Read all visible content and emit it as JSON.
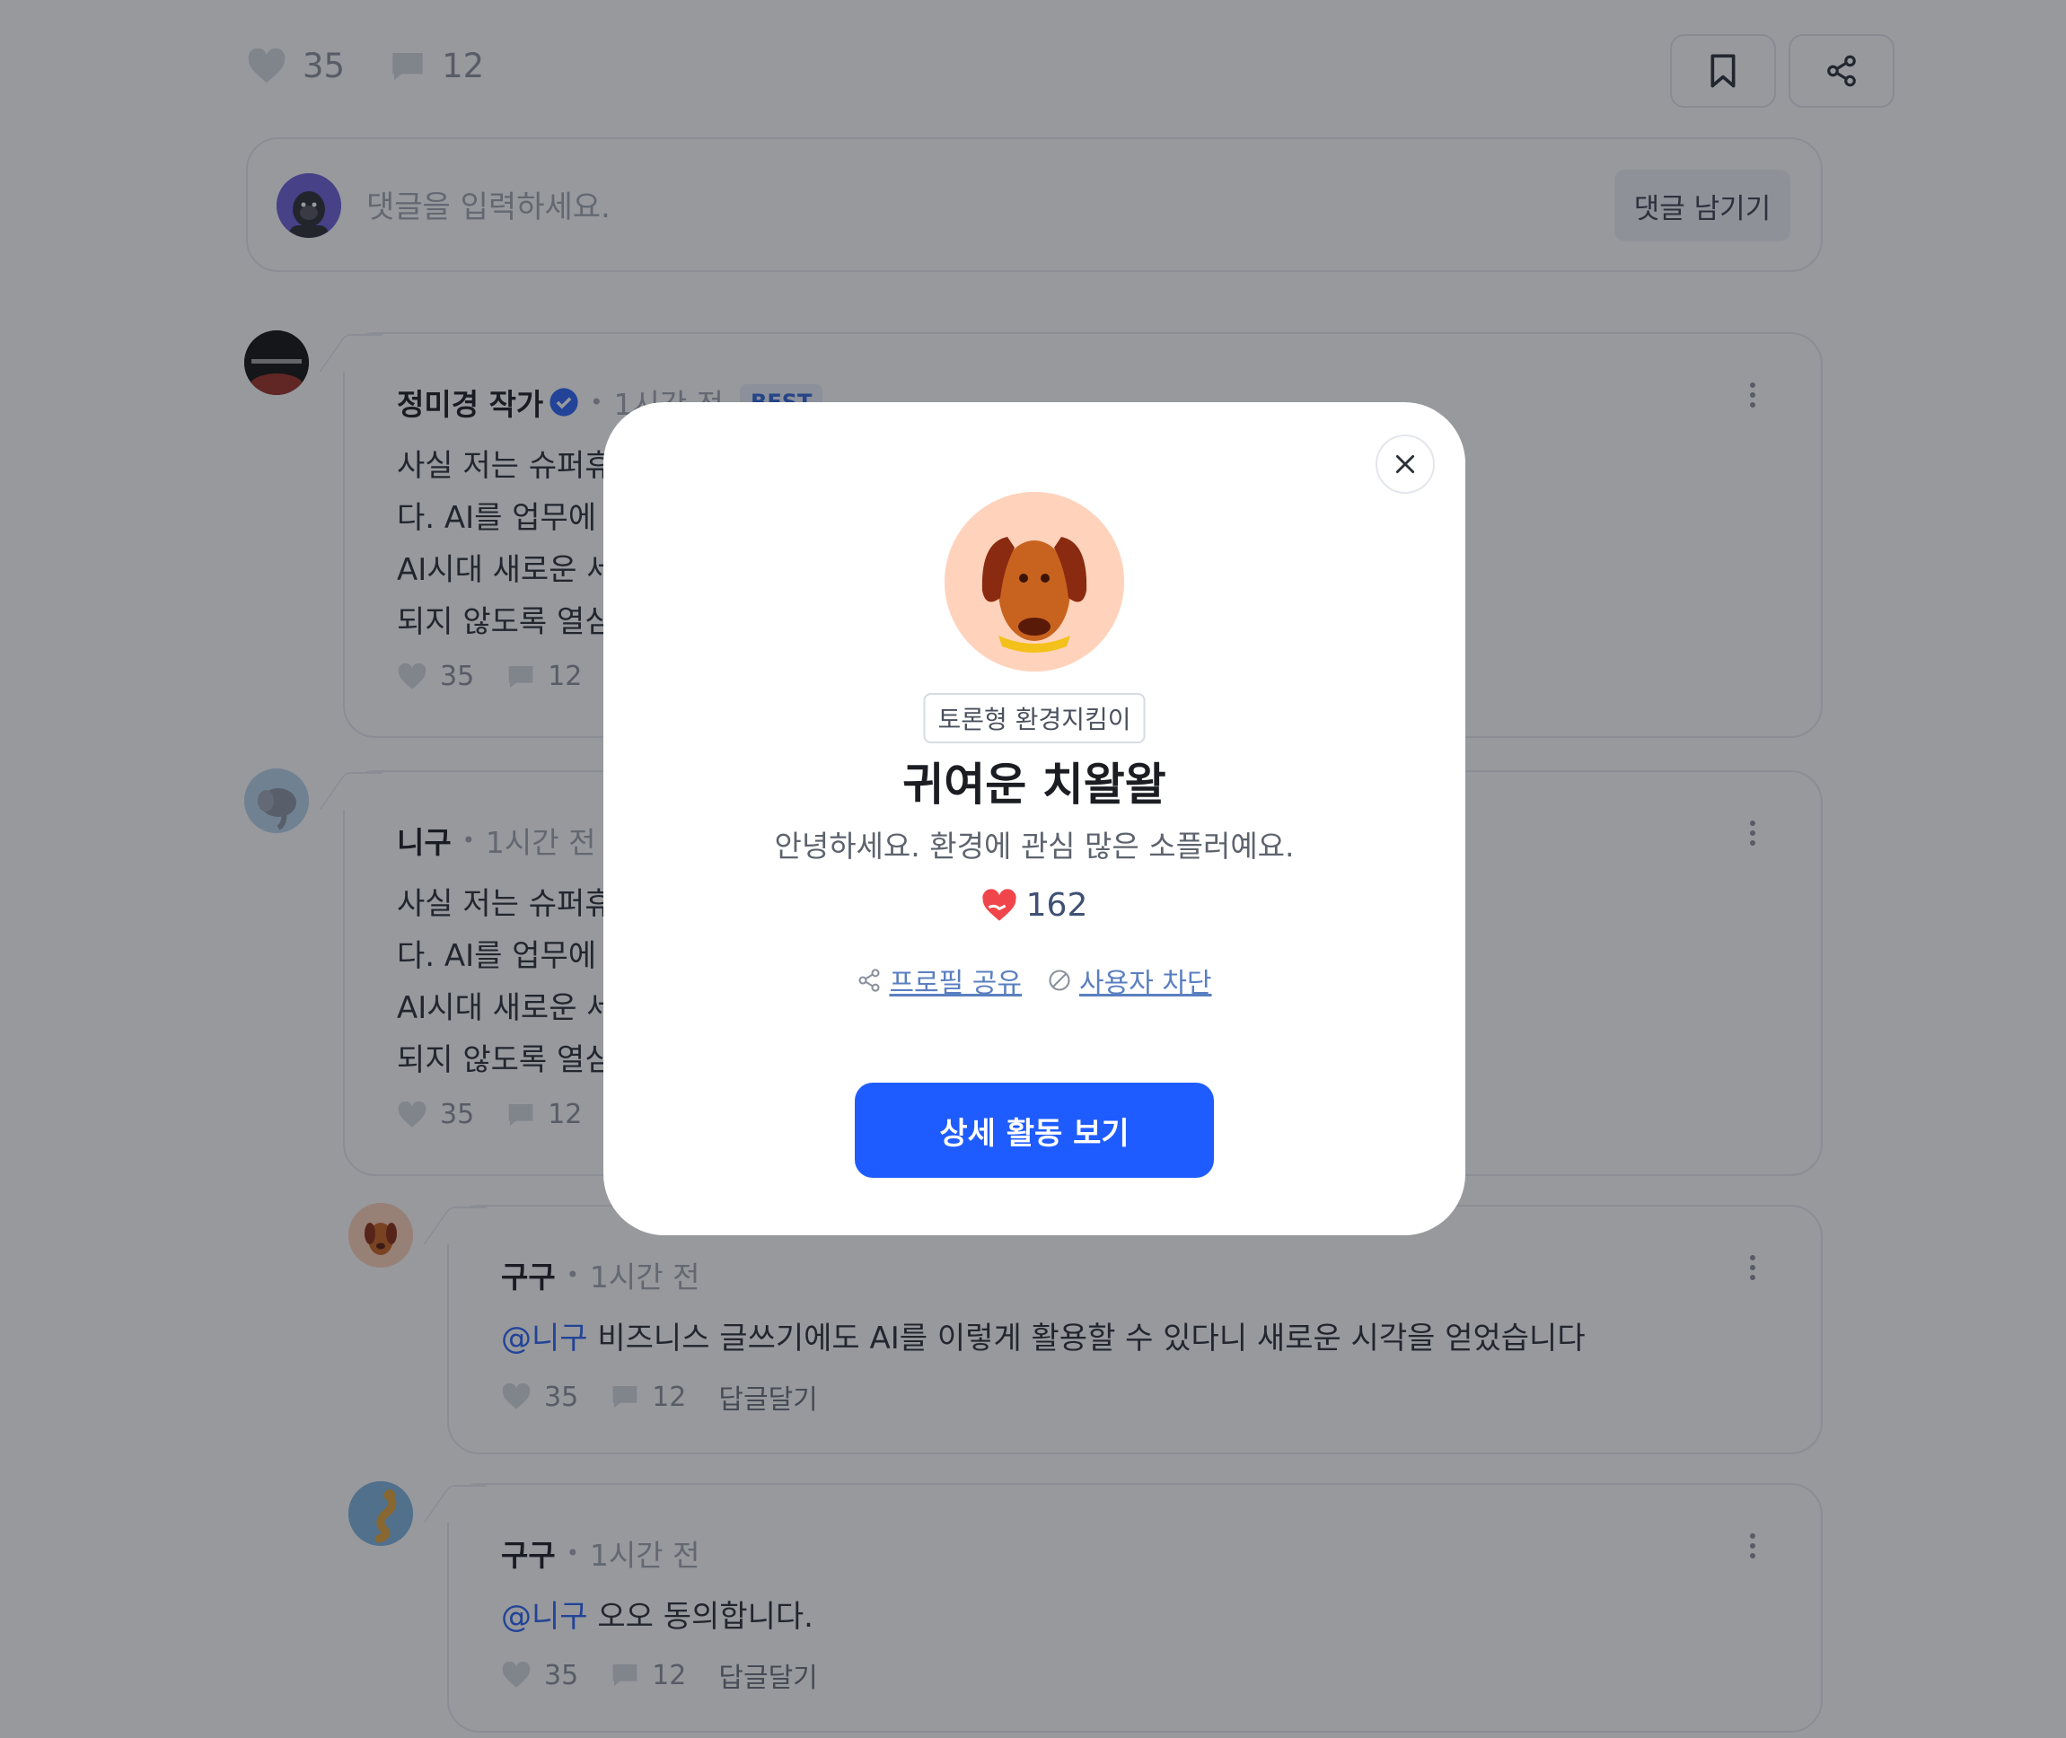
{
  "post": {
    "likes": "35",
    "comments": "12"
  },
  "comment_box": {
    "placeholder": "댓글을 입력하세요.",
    "submit_label": "댓글 남기기"
  },
  "comments": [
    {
      "author": "정미경 작가",
      "time": "1시간 전",
      "badge": "BEST",
      "lines": [
        "사실 저는 슈퍼휴먼까지는 아니고 AI 시대를 따라가기 벅차고 스트레스도 심합니",
        "다. AI를 업무에 적용하는 방법을 찾아야 할 것 같아요.",
        "AI시대 새로운 세대가 어쩌면 우리보다 나은 점이 있을지도 모르겠네요. 후자가",
        "되지 않도록 열심히 노력해야겠습니다."
      ],
      "likes": "35",
      "replies": "12"
    },
    {
      "author": "니구",
      "time": "1시간 전",
      "lines": [
        "사실 저는 슈퍼휴먼까지는 아니고 AI 시대를 따라가기 벅차고 스트레스도 심합니",
        "다. AI를 업무에 적용하는 방법을 찾아야 할 것 같아요.",
        "AI시대 새로운 세대가 어쩌면 우리보다 나은 점이 있을지도 모르겠네요. 후자가",
        "되지 않도록 열심히 노력해야겠습니다."
      ],
      "likes": "35",
      "replies": "12"
    },
    {
      "author": "구구",
      "time": "1시간 전",
      "mention": "@니구",
      "text": " 비즈니스 글쓰기에도 AI를 이렇게 활용할 수 있다니 새로운 시각을 얻었습니다",
      "likes": "35",
      "replies": "12",
      "reply_label": "답글달기"
    },
    {
      "author": "구구",
      "time": "1시간 전",
      "mention": "@니구",
      "text": " 오오 동의합니다.",
      "likes": "35",
      "replies": "12",
      "reply_label": "답글달기"
    }
  ],
  "profile_modal": {
    "tag": "토론형 환경지킴이",
    "nickname": "귀여운 치왈왈",
    "intro": "안녕하세요. 환경에 관심 많은 소플러예요.",
    "like_count": "162",
    "share_label": "프로필 공유",
    "block_label": "사용자 차단",
    "cta_label": "상세 활동 보기"
  },
  "colors": {
    "primary": "#1f5cff",
    "mention": "#2b63f5",
    "heart": "#f0454a"
  }
}
